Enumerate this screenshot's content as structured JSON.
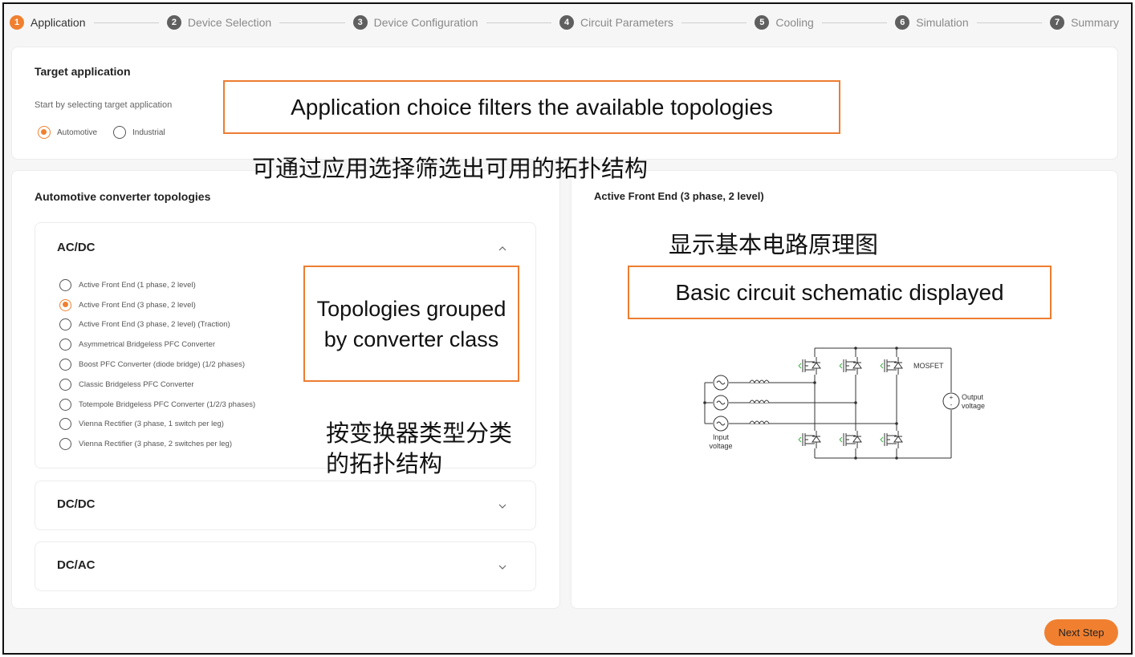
{
  "stepper": {
    "steps": [
      {
        "num": "1",
        "label": "Application",
        "active": true
      },
      {
        "num": "2",
        "label": "Device Selection",
        "active": false
      },
      {
        "num": "3",
        "label": "Device Configuration",
        "active": false
      },
      {
        "num": "4",
        "label": "Circuit Parameters",
        "active": false
      },
      {
        "num": "5",
        "label": "Cooling",
        "active": false
      },
      {
        "num": "6",
        "label": "Simulation",
        "active": false
      },
      {
        "num": "7",
        "label": "Summary",
        "active": false
      }
    ]
  },
  "target": {
    "title": "Target application",
    "subtitle": "Start by selecting target application",
    "options": [
      {
        "label": "Automotive",
        "checked": true
      },
      {
        "label": "Industrial",
        "checked": false
      }
    ]
  },
  "topologies": {
    "title": "Automotive converter topologies",
    "groups": [
      {
        "label": "AC/DC",
        "expanded": true,
        "items": [
          {
            "label": "Active Front End (1 phase, 2 level)",
            "checked": false
          },
          {
            "label": "Active Front End (3 phase, 2 level)",
            "checked": true
          },
          {
            "label": "Active Front End (3 phase, 2 level) (Traction)",
            "checked": false
          },
          {
            "label": "Asymmetrical Bridgeless PFC Converter",
            "checked": false
          },
          {
            "label": "Boost PFC Converter (diode bridge) (1/2 phases)",
            "checked": false
          },
          {
            "label": "Classic Bridgeless PFC Converter",
            "checked": false
          },
          {
            "label": "Totempole Bridgeless PFC Converter (1/2/3 phases)",
            "checked": false
          },
          {
            "label": "Vienna Rectifier (3 phase, 1 switch per leg)",
            "checked": false
          },
          {
            "label": "Vienna Rectifier (3 phase, 2 switches per leg)",
            "checked": false
          }
        ]
      },
      {
        "label": "DC/DC",
        "expanded": false
      },
      {
        "label": "DC/AC",
        "expanded": false
      }
    ]
  },
  "schematic": {
    "title": "Active Front End (3 phase, 2 level)",
    "labels": {
      "mosfet": "MOSFET",
      "output_1": "Output",
      "output_2": "voltage",
      "input_1": "Input",
      "input_2": "voltage"
    }
  },
  "footer": {
    "next_label": "Next Step"
  },
  "annotations": {
    "app_choice_en": "Application choice filters the available topologies",
    "app_choice_cn": "可通过应用选择筛选出可用的拓扑结构",
    "grouped_en": "Topologies grouped by converter class",
    "grouped_cn": "按变换器类型分类的拓扑结构",
    "schematic_en": "Basic circuit schematic displayed",
    "schematic_cn": "显示基本电路原理图"
  },
  "colors": {
    "accent": "#f08030",
    "annotation_border": "#ed7d31",
    "step_inactive": "#5f5f5f"
  }
}
